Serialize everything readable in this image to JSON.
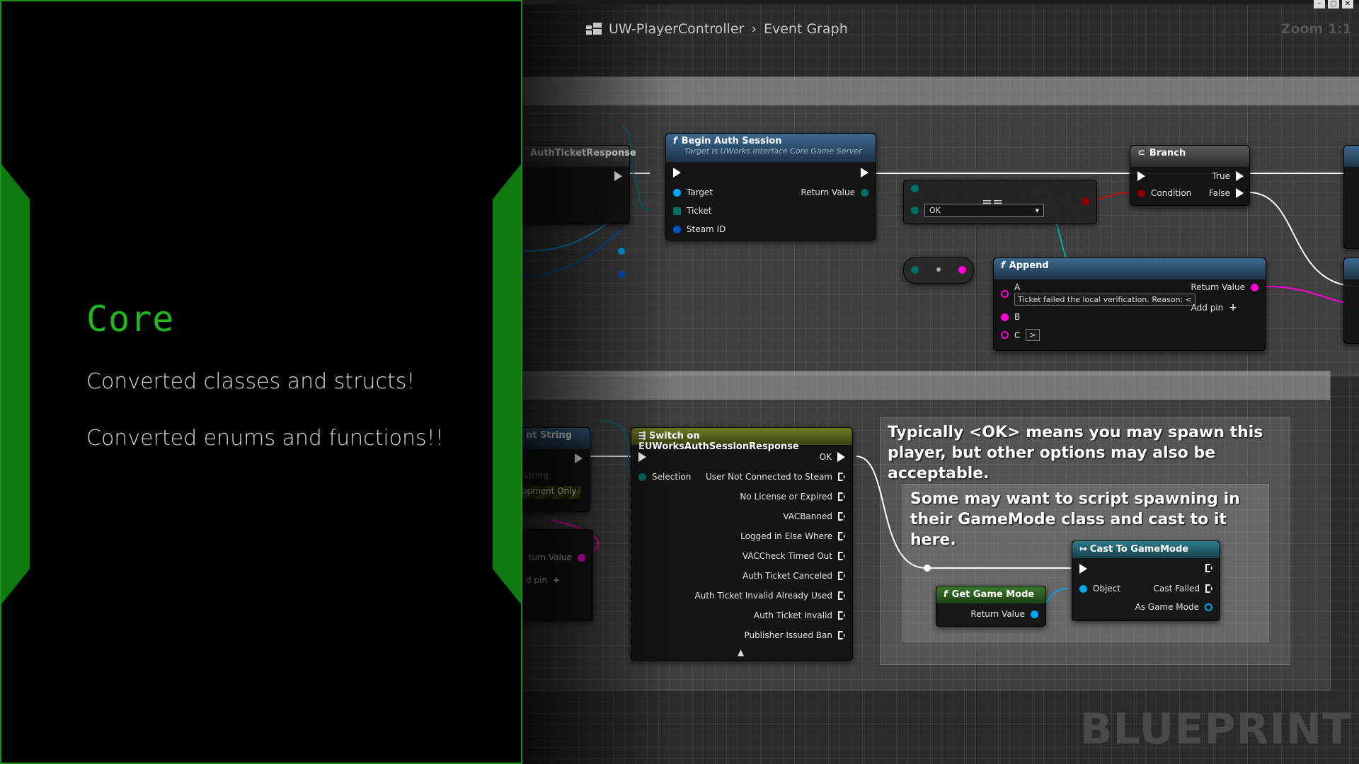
{
  "promo": {
    "heading": "Core",
    "line1": "Converted classes and structs!",
    "line2": "Converted enums and functions!!"
  },
  "editor": {
    "breadcrumb": {
      "asset": "UW-PlayerController",
      "graph": "Event Graph"
    },
    "zoom": "Zoom 1:1",
    "watermark": "BLUEPRINT",
    "colors": {
      "exec": "#ffffff",
      "object": "#00a8f4",
      "string": "#ff00d4",
      "byte": "#006f65",
      "bool": "#8c0000",
      "struct": "#0058c8"
    }
  },
  "nodes": {
    "auth_ticket_event": {
      "title": "AuthTicketResponse"
    },
    "begin_auth": {
      "title": "Begin Auth Session",
      "subtitle": "Target is UWorks Interface Core Game Server",
      "pins_in": [
        "Target",
        "Ticket",
        "Steam ID"
      ],
      "pin_out": "Return Value"
    },
    "equal_enum": {
      "value": "OK"
    },
    "branch": {
      "title": "Branch",
      "pin_in": "Condition",
      "pin_true": "True",
      "pin_false": "False"
    },
    "append": {
      "title": "Append",
      "pin_a": "A",
      "pin_a_value": "Ticket failed the local verification. Reason: <",
      "pin_b": "B",
      "pin_c": "C",
      "pin_c_value": ">",
      "pin_out": "Return Value",
      "add_pin": "Add pin"
    },
    "partial_string": {
      "title": "nt String",
      "row1": "String",
      "row2": "opment Only"
    },
    "partial_left2": {
      "row1": "turn Value",
      "row2": "d pin"
    },
    "switch": {
      "title": "Switch on EUWorksAuthSessionResponse",
      "pin_in": "Selection",
      "outputs": [
        "OK",
        "User Not Connected to Steam",
        "No License or Expired",
        "VACBanned",
        "Logged in Else Where",
        "VACCheck Timed Out",
        "Auth Ticket Canceled",
        "Auth Ticket Invalid Already Used",
        "Auth Ticket Invalid",
        "Publisher Issued Ban"
      ]
    },
    "get_game_mode": {
      "title": "Get Game Mode",
      "pin_out": "Return Value"
    },
    "cast": {
      "title": "Cast To GameMode",
      "pin_in": "Object",
      "pin_failed": "Cast Failed",
      "pin_out": "As Game Mode"
    }
  },
  "comments": {
    "outer": "Typically <OK> means you may spawn this player, but other options may also be acceptable.",
    "inner": "Some may want to script spawning in their GameMode class and cast to it here."
  }
}
